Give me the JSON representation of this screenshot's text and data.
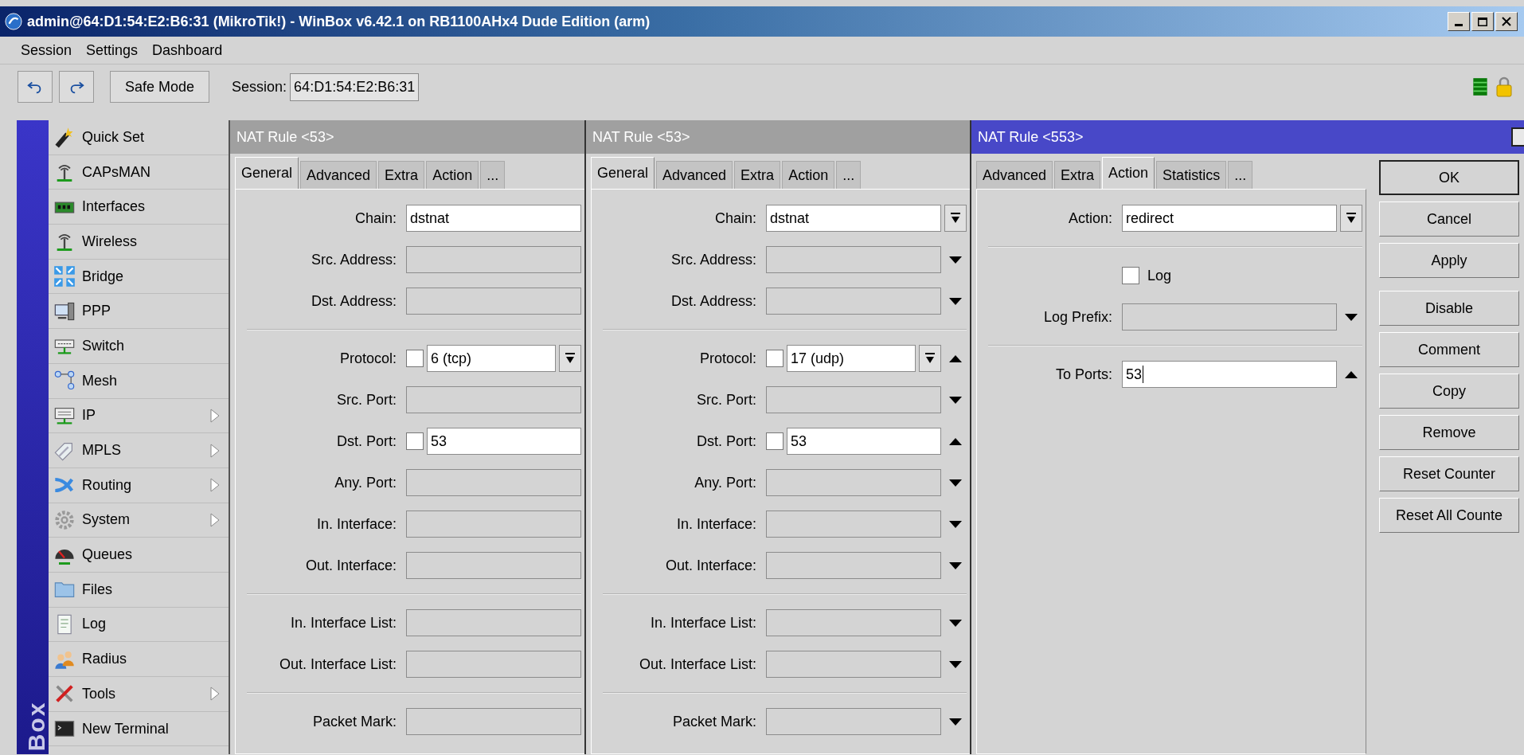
{
  "window": {
    "title": "admin@64:D1:54:E2:B6:31 (MikroTik!) - WinBox v6.42.1 on RB1100AHx4 Dude Edition (arm)"
  },
  "menu": [
    "Session",
    "Settings",
    "Dashboard"
  ],
  "toolbar": {
    "safe_mode": "Safe Mode",
    "session_label": "Session:",
    "session_value": "64:D1:54:E2:B6:31"
  },
  "sidebar": {
    "brand": "Box",
    "items": [
      {
        "label": "Quick Set",
        "submenu": false
      },
      {
        "label": "CAPsMAN",
        "submenu": false
      },
      {
        "label": "Interfaces",
        "submenu": false
      },
      {
        "label": "Wireless",
        "submenu": false
      },
      {
        "label": "Bridge",
        "submenu": false
      },
      {
        "label": "PPP",
        "submenu": false
      },
      {
        "label": "Switch",
        "submenu": false
      },
      {
        "label": "Mesh",
        "submenu": false
      },
      {
        "label": "IP",
        "submenu": true
      },
      {
        "label": "MPLS",
        "submenu": true
      },
      {
        "label": "Routing",
        "submenu": true
      },
      {
        "label": "System",
        "submenu": true
      },
      {
        "label": "Queues",
        "submenu": false
      },
      {
        "label": "Files",
        "submenu": false
      },
      {
        "label": "Log",
        "submenu": false
      },
      {
        "label": "Radius",
        "submenu": false
      },
      {
        "label": "Tools",
        "submenu": true
      },
      {
        "label": "New Terminal",
        "submenu": false
      }
    ]
  },
  "dialogs": [
    {
      "title": "NAT Rule <53>",
      "active": false,
      "tabs": [
        {
          "label": "General",
          "selected": true
        },
        {
          "label": "Advanced",
          "selected": false
        },
        {
          "label": "Extra",
          "selected": false
        },
        {
          "label": "Action",
          "selected": false
        },
        {
          "label": "...",
          "selected": false
        }
      ],
      "rows": [
        {
          "kind": "field",
          "label": "Chain:",
          "value": "dstnat"
        },
        {
          "kind": "field",
          "label": "Src. Address:"
        },
        {
          "kind": "field",
          "label": "Dst. Address:"
        },
        {
          "kind": "separator"
        },
        {
          "kind": "field",
          "label": "Protocol:",
          "negated": false,
          "value": "6 (tcp)",
          "dropdown": true
        },
        {
          "kind": "field",
          "label": "Src. Port:"
        },
        {
          "kind": "field",
          "label": "Dst. Port:",
          "negated": false,
          "value": "53"
        },
        {
          "kind": "field",
          "label": "Any. Port:"
        },
        {
          "kind": "field",
          "label": "In. Interface:"
        },
        {
          "kind": "field",
          "label": "Out. Interface:"
        },
        {
          "kind": "separator"
        },
        {
          "kind": "field",
          "label": "In. Interface List:"
        },
        {
          "kind": "field",
          "label": "Out. Interface List:"
        },
        {
          "kind": "separator"
        },
        {
          "kind": "field",
          "label": "Packet Mark:"
        }
      ]
    },
    {
      "title": "NAT Rule <53>",
      "active": false,
      "tabs": [
        {
          "label": "General",
          "selected": true
        },
        {
          "label": "Advanced",
          "selected": false
        },
        {
          "label": "Extra",
          "selected": false
        },
        {
          "label": "Action",
          "selected": false
        },
        {
          "label": "...",
          "selected": false
        }
      ],
      "rows": [
        {
          "kind": "field",
          "label": "Chain:",
          "value": "dstnat",
          "dropdown": true
        },
        {
          "kind": "field",
          "label": "Src. Address:",
          "expand": true
        },
        {
          "kind": "field",
          "label": "Dst. Address:",
          "expand": true
        },
        {
          "kind": "separator"
        },
        {
          "kind": "field",
          "label": "Protocol:",
          "negated": false,
          "value": "17 (udp)",
          "dropdown": true,
          "collapse": true
        },
        {
          "kind": "field",
          "label": "Src. Port:",
          "expand": true
        },
        {
          "kind": "field",
          "label": "Dst. Port:",
          "negated": false,
          "value": "53",
          "collapse": true
        },
        {
          "kind": "field",
          "label": "Any. Port:",
          "expand": true
        },
        {
          "kind": "field",
          "label": "In. Interface:",
          "expand": true
        },
        {
          "kind": "field",
          "label": "Out. Interface:",
          "expand": true
        },
        {
          "kind": "separator"
        },
        {
          "kind": "field",
          "label": "In. Interface List:",
          "expand": true
        },
        {
          "kind": "field",
          "label": "Out. Interface List:",
          "expand": true
        },
        {
          "kind": "separator"
        },
        {
          "kind": "field",
          "label": "Packet Mark:",
          "expand": true
        }
      ]
    },
    {
      "title": "NAT Rule <553>",
      "active": true,
      "tabs": [
        {
          "label": "Advanced",
          "selected": false
        },
        {
          "label": "Extra",
          "selected": false
        },
        {
          "label": "Action",
          "selected": true
        },
        {
          "label": "Statistics",
          "selected": false
        },
        {
          "label": "...",
          "selected": false
        }
      ],
      "rows": [
        {
          "kind": "field",
          "label": "Action:",
          "value": "redirect",
          "dropdown": true
        },
        {
          "kind": "separator"
        },
        {
          "kind": "checkbox",
          "label": "Log",
          "checked": false
        },
        {
          "kind": "field",
          "label": "Log Prefix:",
          "expand": true
        },
        {
          "kind": "separator"
        },
        {
          "kind": "field",
          "label": "To Ports:",
          "value": "53",
          "collapse": true,
          "focused": true
        }
      ],
      "button_groups": [
        [
          {
            "label": "OK",
            "default": true
          },
          {
            "label": "Cancel",
            "default": false
          },
          {
            "label": "Apply",
            "default": false
          }
        ],
        [
          {
            "label": "Disable",
            "default": false
          },
          {
            "label": "Comment",
            "default": false
          },
          {
            "label": "Copy",
            "default": false
          },
          {
            "label": "Remove",
            "default": false
          },
          {
            "label": "Reset Counter",
            "default": false
          },
          {
            "label": "Reset All Counte",
            "default": false
          }
        ]
      ]
    }
  ]
}
